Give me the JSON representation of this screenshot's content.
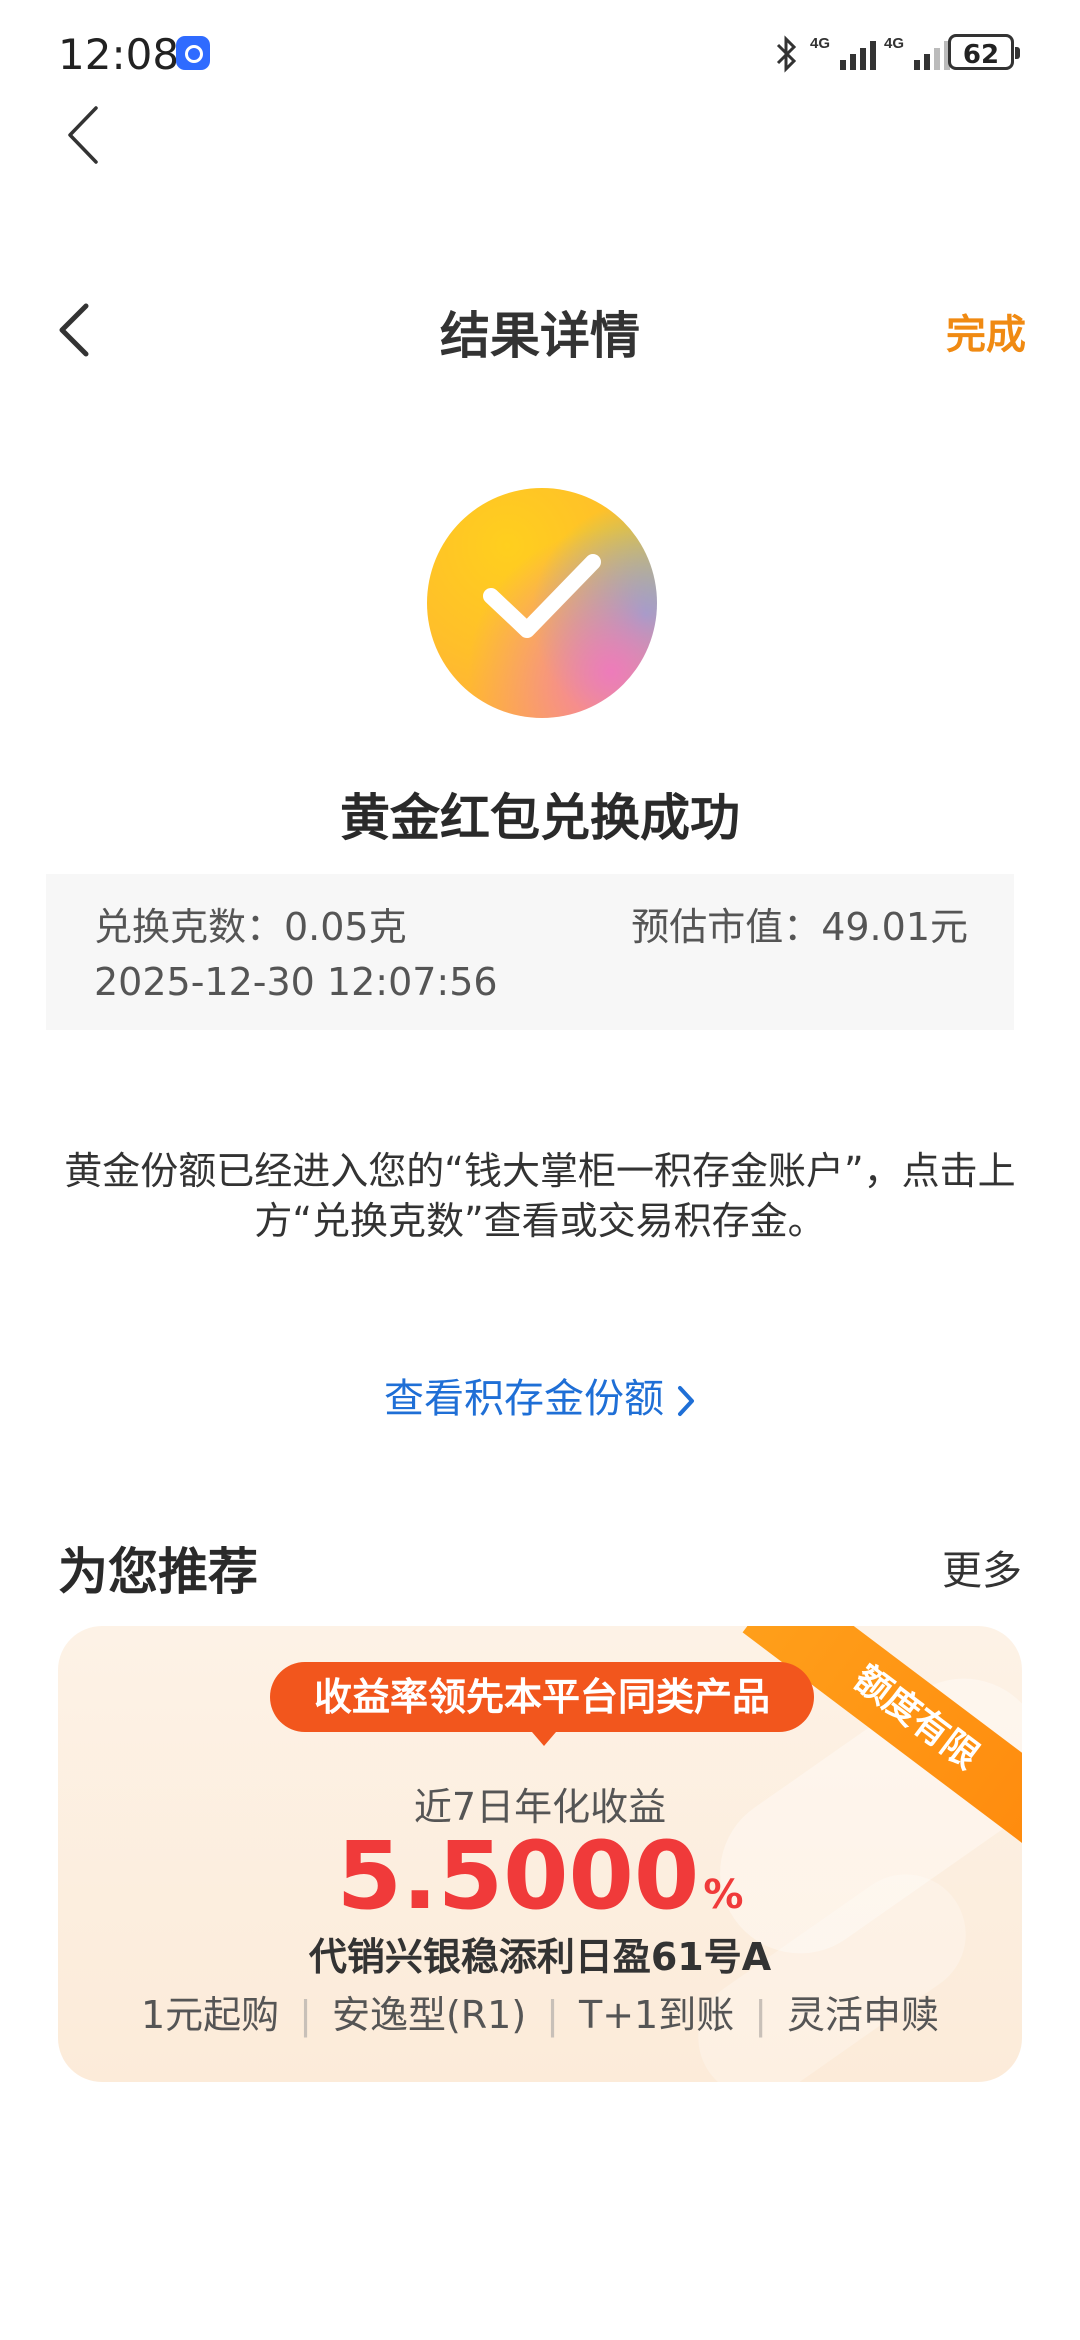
{
  "status_bar": {
    "time": "12:08",
    "battery": "62",
    "network_1": "4G",
    "network_2": "4G"
  },
  "nav": {
    "title": "结果详情",
    "done_label": "完成"
  },
  "result": {
    "title": "黄金红包兑换成功",
    "grams_label": "兑换克数：0.05克",
    "value_label": "预估市值：49.01元",
    "timestamp": "2025-12-30 12:07:56",
    "description": "黄金份额已经进入您的“钱大掌柜一积存金账户”，点击上方“兑换克数”查看或交易积存金。",
    "link_label": "查看积存金份额"
  },
  "recommend": {
    "title": "为您推荐",
    "more_label": "更多",
    "card": {
      "ribbon": "额度有限",
      "pill": "收益率领先本平台同类产品",
      "yield_label": "近7日年化收益",
      "yield_value": "5.5000",
      "yield_unit": "%",
      "product_name": "代销兴银稳添利日盈61号A",
      "tags": [
        "1元起购",
        "安逸型(R1)",
        "T+1到账",
        "灵活申赎"
      ]
    }
  },
  "colors": {
    "accent_orange": "#f08a12",
    "link_blue": "#1f6fd6",
    "yield_red": "#f03a3a",
    "pill_orange": "#f2561d"
  }
}
